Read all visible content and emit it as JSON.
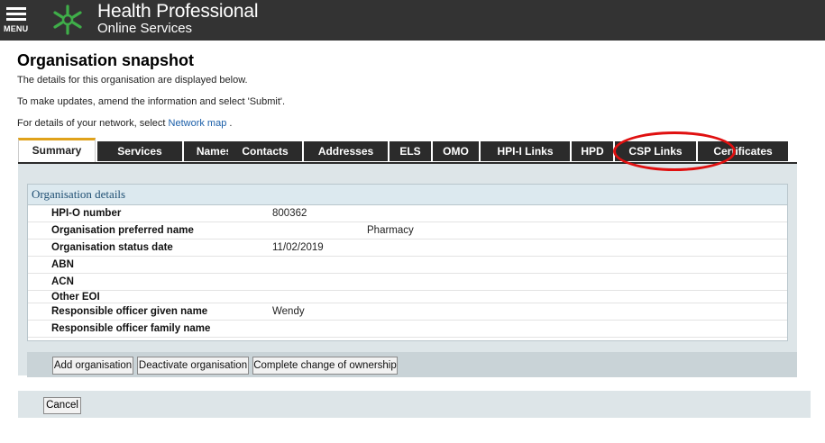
{
  "header": {
    "menu_label": "MENU",
    "brand_line1": "Health Professional",
    "brand_line2": "Online Services"
  },
  "page": {
    "title": "Organisation snapshot",
    "intro1": "The details for this organisation are displayed below.",
    "intro2": "To make updates, amend the information and select 'Submit'.",
    "intro3_prefix": "For details of your network, select ",
    "intro3_link": "Network map",
    "intro3_suffix": " ."
  },
  "tabs": [
    {
      "label": "Summary",
      "active": true
    },
    {
      "label": "Services"
    },
    {
      "label": "Names"
    },
    {
      "label": "Contacts"
    },
    {
      "label": "Addresses"
    },
    {
      "label": "ELS"
    },
    {
      "label": "OMO"
    },
    {
      "label": "HPI-I Links"
    },
    {
      "label": "HPD"
    },
    {
      "label": "CSP Links"
    },
    {
      "label": "Certificates"
    }
  ],
  "details": {
    "heading": "Organisation details",
    "rows": [
      {
        "label": "HPI-O number",
        "value": "800362"
      },
      {
        "label": "Organisation preferred name",
        "value": "Pharmacy"
      },
      {
        "label": "Organisation status date",
        "value": "11/02/2019"
      },
      {
        "label": "ABN",
        "value": ""
      },
      {
        "label": "ACN",
        "value": ""
      },
      {
        "label": "Other EOI",
        "value": ""
      },
      {
        "label": "Responsible officer given name",
        "value": "Wendy"
      },
      {
        "label": "Responsible officer family name",
        "value": ""
      }
    ]
  },
  "actions": {
    "add": "Add organisation",
    "deactivate": "Deactivate organisation",
    "change_owner": "Complete change of ownership"
  },
  "cancel_label": "Cancel",
  "colors": {
    "topbar": "#333333",
    "active_tab_accent": "#e0a21b",
    "annotation_circle": "#e01010",
    "link": "#1a5ea8"
  }
}
